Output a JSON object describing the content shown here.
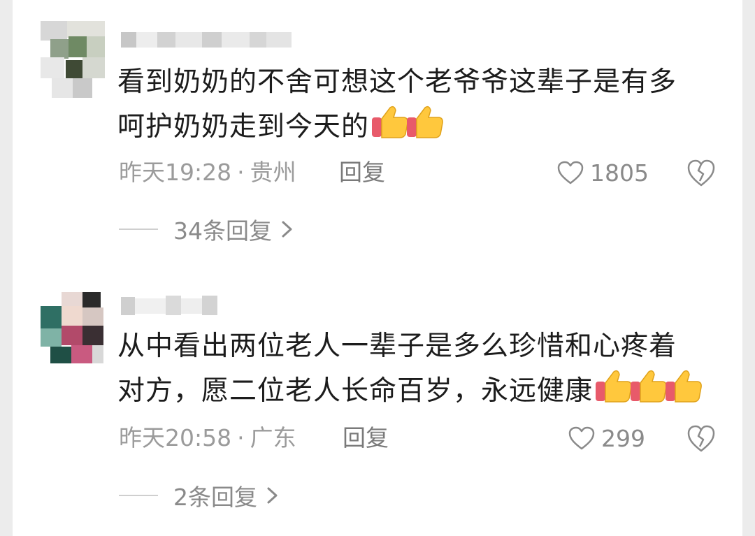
{
  "comments": [
    {
      "text_line1": "看到奶奶的不舍可想这个老爷爷这辈子是有多",
      "text_line2": "呵护奶奶走到今天的",
      "time": "昨天19:28",
      "separator": "·",
      "location": "贵州",
      "reply_label": "回复",
      "likes": "1805",
      "replies_label": "34条回复",
      "thumbs_count": 2
    },
    {
      "text_line1": "从中看出两位老人一辈子是多么珍惜和心疼着",
      "text_line2": "对方，愿二位老人长命百岁，永远健康",
      "time": "昨天20:58",
      "separator": "·",
      "location": "广东",
      "reply_label": "回复",
      "likes": "299",
      "replies_label": "2条回复",
      "thumbs_count": 3
    }
  ],
  "icons": {
    "like": "heart-outline-icon",
    "dislike": "broken-heart-icon",
    "more": "chevron-right-icon",
    "emoji": "thumbs-up-emoji"
  },
  "colors": {
    "text": "#1c1c1c",
    "meta": "#9b9b9b",
    "emoji_yellow": "#ffc83d",
    "emoji_cuff": "#e85a6a"
  }
}
